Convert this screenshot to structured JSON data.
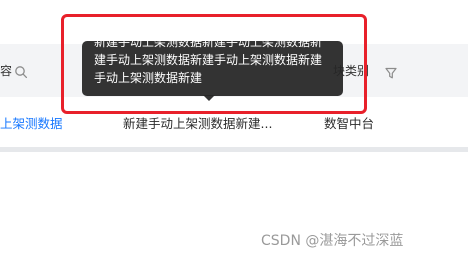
{
  "table": {
    "header": {
      "col1_partial": "容",
      "col3_partial": "块类别"
    },
    "rows": [
      {
        "link": "上架测数据",
        "name": "新建手动上架测数据新建...",
        "module": "数智中台"
      }
    ]
  },
  "tooltip": {
    "text": "新建手动上架测数据新建手动上架测数据新建手动上架测数据新建手动上架测数据新建手动上架测数据新建"
  },
  "watermark": {
    "text": "CSDN @湛海不过深蓝"
  },
  "icons": {
    "col1": "search-icon",
    "col3": "filter-icon"
  },
  "colors": {
    "link": "#1677ff",
    "annotation": "#e8202a",
    "tooltip_bg": "#262626",
    "header_bg": "#f3f4f6"
  }
}
